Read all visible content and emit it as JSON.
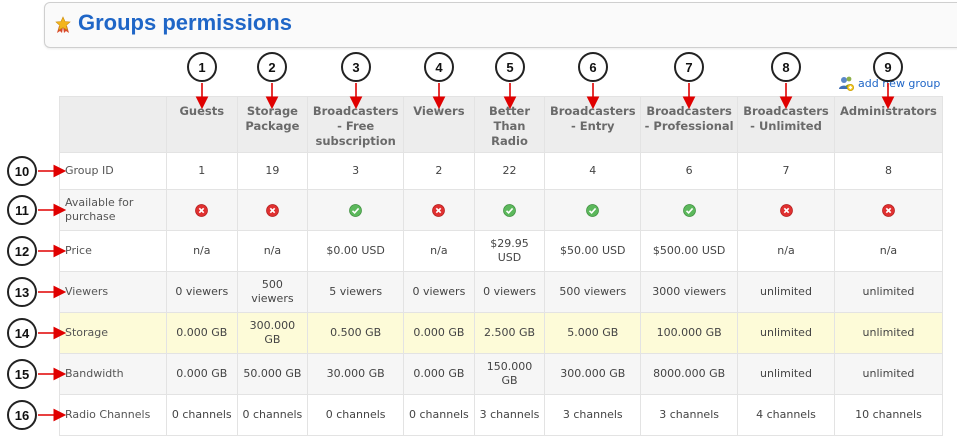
{
  "page": {
    "title": "Groups permissions",
    "title_icon": "award-ribbon-icon",
    "add_group_label": "add new group",
    "accent_color": "#1f66c7"
  },
  "table": {
    "columns": [
      "Guests",
      "Storage Package",
      "Broadcasters - Free subscription",
      "Viewers",
      "Better Than Radio",
      "Broadcasters - Entry",
      "Broadcasters - Professional",
      "Broadcasters - Unlimited",
      "Administrators"
    ],
    "rows": [
      {
        "label": "Group ID",
        "cells": [
          "1",
          "19",
          "3",
          "2",
          "22",
          "4",
          "6",
          "7",
          "8"
        ]
      },
      {
        "label": "Available for purchase",
        "cells": [
          "no",
          "no",
          "yes",
          "no",
          "yes",
          "yes",
          "yes",
          "no",
          "no"
        ],
        "type": "status"
      },
      {
        "label": "Price",
        "cells": [
          "n/a",
          "n/a",
          "$0.00 USD",
          "n/a",
          "$29.95 USD",
          "$50.00 USD",
          "$500.00 USD",
          "n/a",
          "n/a"
        ]
      },
      {
        "label": "Viewers",
        "cells": [
          "0 viewers",
          "500 viewers",
          "5 viewers",
          "0 viewers",
          "0 viewers",
          "500 viewers",
          "3000 viewers",
          "unlimited",
          "unlimited"
        ]
      },
      {
        "label": "Storage",
        "cells": [
          "0.000 GB",
          "300.000 GB",
          "0.500 GB",
          "0.000 GB",
          "2.500 GB",
          "5.000 GB",
          "100.000 GB",
          "unlimited",
          "unlimited"
        ]
      },
      {
        "label": "Bandwidth",
        "cells": [
          "0.000 GB",
          "50.000 GB",
          "30.000 GB",
          "0.000 GB",
          "150.000 GB",
          "300.000 GB",
          "8000.000 GB",
          "unlimited",
          "unlimited"
        ]
      },
      {
        "label": "Radio Channels",
        "cells": [
          "0 channels",
          "0 channels",
          "0 channels",
          "0 channels",
          "3 channels",
          "3 channels",
          "3 channels",
          "4 channels",
          "10 channels"
        ]
      }
    ],
    "highlight_row": "Storage",
    "status_colors": {
      "yes": "#5cb85c",
      "no": "#e03030"
    }
  },
  "callouts": {
    "column_numbers": [
      "1",
      "2",
      "3",
      "4",
      "5",
      "6",
      "7",
      "8",
      "9"
    ],
    "row_numbers": [
      "10",
      "11",
      "12",
      "13",
      "14",
      "15",
      "16"
    ],
    "arrow_color": "#e00000"
  }
}
